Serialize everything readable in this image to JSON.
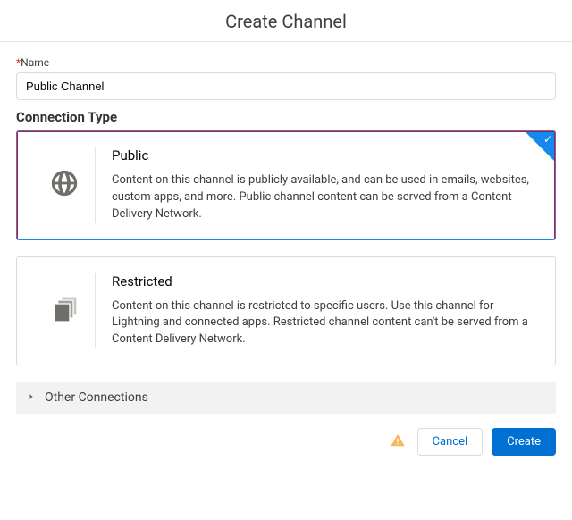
{
  "header": {
    "title": "Create Channel"
  },
  "form": {
    "name": {
      "label": "Name",
      "required_marker": "*",
      "value": "Public Channel"
    },
    "connection_type": {
      "title": "Connection Type",
      "options": {
        "public": {
          "title": "Public",
          "description": "Content on this channel is publicly available, and can be used in emails, websites, custom apps, and more. Public channel content can be served from a Content Delivery Network.",
          "selected": true
        },
        "restricted": {
          "title": "Restricted",
          "description": "Content on this channel is restricted to specific users. Use this channel for Lightning and connected apps. Restricted channel content can't be served from a Content Delivery Network.",
          "selected": false
        }
      }
    },
    "other_connections": {
      "label": "Other Connections"
    }
  },
  "footer": {
    "cancel": "Cancel",
    "create": "Create"
  }
}
